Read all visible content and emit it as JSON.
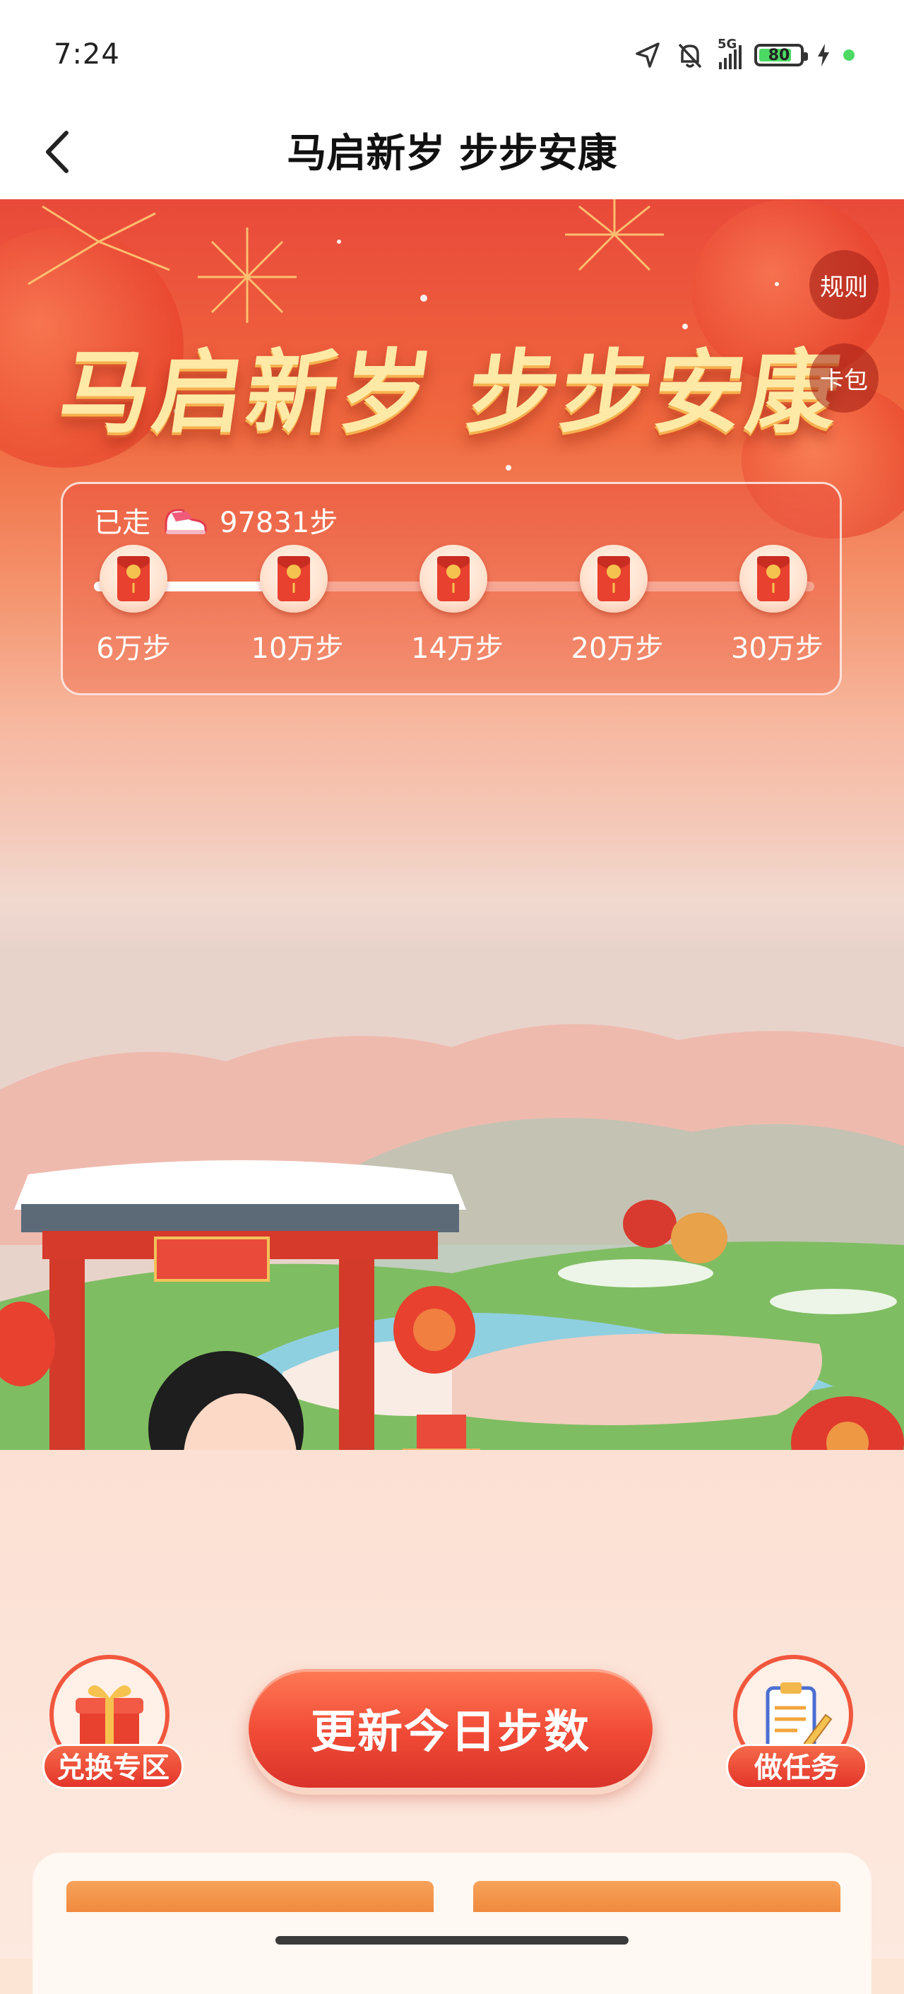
{
  "status_bar": {
    "time": "7:24",
    "network": "5G",
    "battery_level": "80",
    "battery_fraction": 0.8,
    "icons": [
      "location-arrow-icon",
      "bell-mute-icon",
      "signal-icon",
      "battery-icon",
      "charging-bolt-icon"
    ]
  },
  "nav": {
    "back_icon": "chevron-left-icon",
    "title": "马启新岁 步步安康"
  },
  "hero": {
    "title": "马启新岁 步步安康",
    "rules_label": "规则",
    "wallet_label": "卡包"
  },
  "progress": {
    "walked_label": "已走",
    "steps_text": "97831步",
    "steps_value": 97831,
    "milestones": [
      {
        "label": "6万步",
        "steps": 60000
      },
      {
        "label": "10万步",
        "steps": 100000
      },
      {
        "label": "14万步",
        "steps": 140000
      },
      {
        "label": "20万步",
        "steps": 200000
      },
      {
        "label": "30万步",
        "steps": 300000
      }
    ]
  },
  "actions": {
    "exchange_label": "兑换专区",
    "main_button_label": "更新今日步数",
    "task_label": "做任务"
  },
  "colors": {
    "accent_red": "#e94a3a",
    "button_red": "#f04a36",
    "gold": "#ffe9a6"
  }
}
